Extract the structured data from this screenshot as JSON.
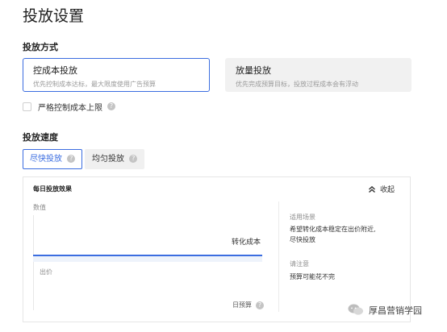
{
  "page": {
    "title": "投放设置"
  },
  "delivery_method": {
    "label": "投放方式",
    "options": [
      {
        "title": "控成本投放",
        "desc": "优先控制成本达标，最大限度使用广告预算",
        "selected": true
      },
      {
        "title": "放量投放",
        "desc": "优先完成预算目标，投放过程成本会有浮动",
        "selected": false
      }
    ],
    "strict_cost_label": "严格控制成本上限",
    "help_glyph": "?"
  },
  "delivery_speed": {
    "label": "投放速度",
    "tabs": [
      {
        "label": "尽快投放",
        "active": true
      },
      {
        "label": "均匀投放",
        "active": false
      }
    ]
  },
  "daily_effect": {
    "title": "每日投放效果",
    "collapse_label": "收起",
    "collapse_icon": "double-chevron-up-icon",
    "chart": {
      "y_label": "数值",
      "line_label": "转化成本",
      "bid_label": "出价",
      "x_label": "日预算"
    },
    "info": {
      "scenario_title": "适用场景",
      "scenario_text_1": "希望转化成本稳定在出价附近,",
      "scenario_text_2": "尽快投放",
      "note_title": "请注意",
      "note_text": "预算可能花不完"
    }
  },
  "watermark": {
    "text": "厚昌营销学园",
    "icon": "wechat-icon"
  },
  "colors": {
    "accent": "#3b6de0",
    "card_grey": "#f1f1f1",
    "text_muted": "#9a9a9a"
  }
}
